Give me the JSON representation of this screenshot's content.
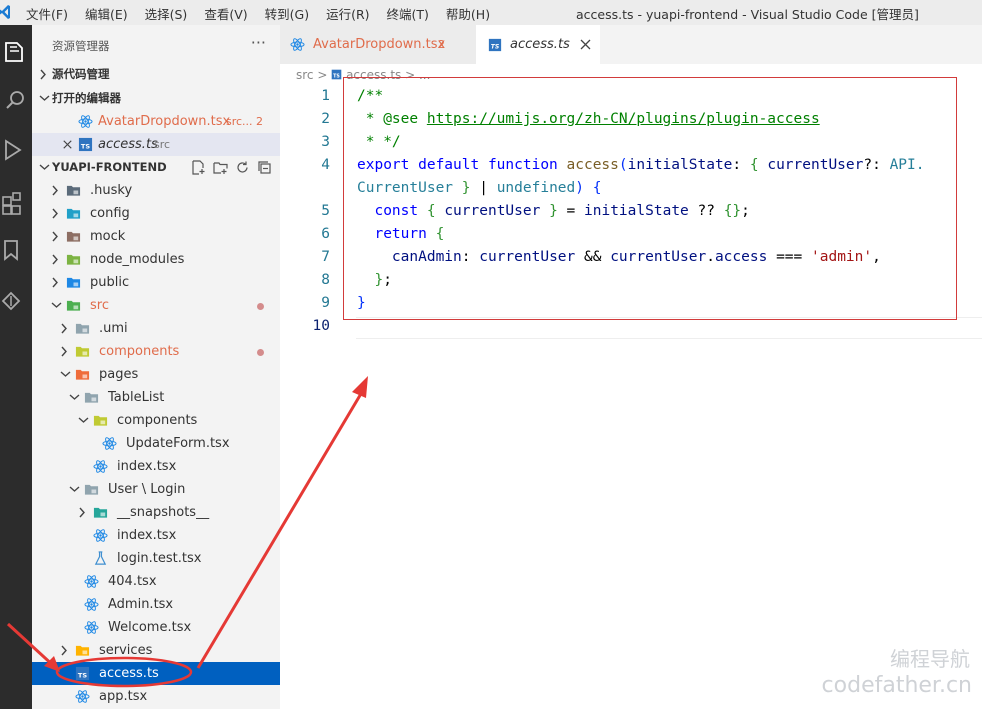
{
  "titlebar": {
    "menu": [
      "文件(F)",
      "编辑(E)",
      "选择(S)",
      "查看(V)",
      "转到(G)",
      "运行(R)",
      "终端(T)",
      "帮助(H)"
    ],
    "window_title": "access.ts - yuapi-frontend - Visual Studio Code [管理员]"
  },
  "sidebar": {
    "header": "资源管理器",
    "more": "···",
    "source_control": "源代码管理",
    "open_editors": {
      "title": "打开的编辑器",
      "items": [
        {
          "name": "AvatarDropdown.tsx",
          "dir": "src...",
          "badge": "2"
        },
        {
          "name": "access.ts",
          "dir": "src"
        }
      ]
    },
    "project": "YUAPI-FRONTEND",
    "tree": [
      ".husky",
      "config",
      "mock",
      "node_modules",
      "public",
      "src",
      ".umi",
      "components",
      "pages",
      "TableList",
      "components",
      "UpdateForm.tsx",
      "index.tsx",
      "User \\ Login",
      "__snapshots__",
      "index.tsx",
      "login.test.tsx",
      "404.tsx",
      "Admin.tsx",
      "Welcome.tsx",
      "services",
      "access.ts",
      "app.tsx"
    ]
  },
  "tabs": [
    {
      "label": "AvatarDropdown.tsx",
      "badge": "2"
    },
    {
      "label": "access.ts",
      "icon_text": "TS"
    }
  ],
  "breadcrumb": {
    "root": "src",
    "file": "access.ts",
    "more": "..."
  },
  "editor": {
    "line_numbers": [
      "1",
      "2",
      "3",
      "4",
      "5",
      "6",
      "7",
      "8",
      "9",
      "10"
    ],
    "code": {
      "l1": "/**",
      "l2a": " * @see ",
      "l2b": "https://umijs.org/zh-CN/plugins/plugin-access",
      "l3": " * */",
      "l4a": "export default function ",
      "l4b": "access",
      "l4c": "(",
      "l4d": "initialState",
      "l4e": ": ",
      "l4f": "{ ",
      "l4g": "currentUser",
      "l4h": "?: ",
      "l4i": "API.",
      "l5a": "CurrentUser",
      "l5b": " } ",
      "l5c": "| ",
      "l5d": "undefined",
      "l5e": ") ",
      "l5f": "{",
      "l6a": "  const ",
      "l6b": "{ ",
      "l6c": "currentUser",
      "l6d": " } ",
      "l6e": "= ",
      "l6f": "initialState",
      "l6g": " ?? ",
      "l6h": "{}",
      "l6i": ";",
      "l7a": "  return ",
      "l7b": "{",
      "l8a": "    canAdmin",
      "l8b": ": ",
      "l8c": "currentUser",
      "l8d": " && ",
      "l8e": "currentUser",
      "l8f": ".",
      "l8g": "access",
      "l8h": " === ",
      "l8i": "'admin'",
      "l8j": ",",
      "l9a": "  }",
      "l9b": ";",
      "l10": "}"
    }
  },
  "watermark": {
    "line1": "编程导航",
    "line2": "codefather.cn"
  },
  "colors": {
    "accent": "#0060c0",
    "annotation": "#e53935",
    "modified": "#e06c4b"
  }
}
